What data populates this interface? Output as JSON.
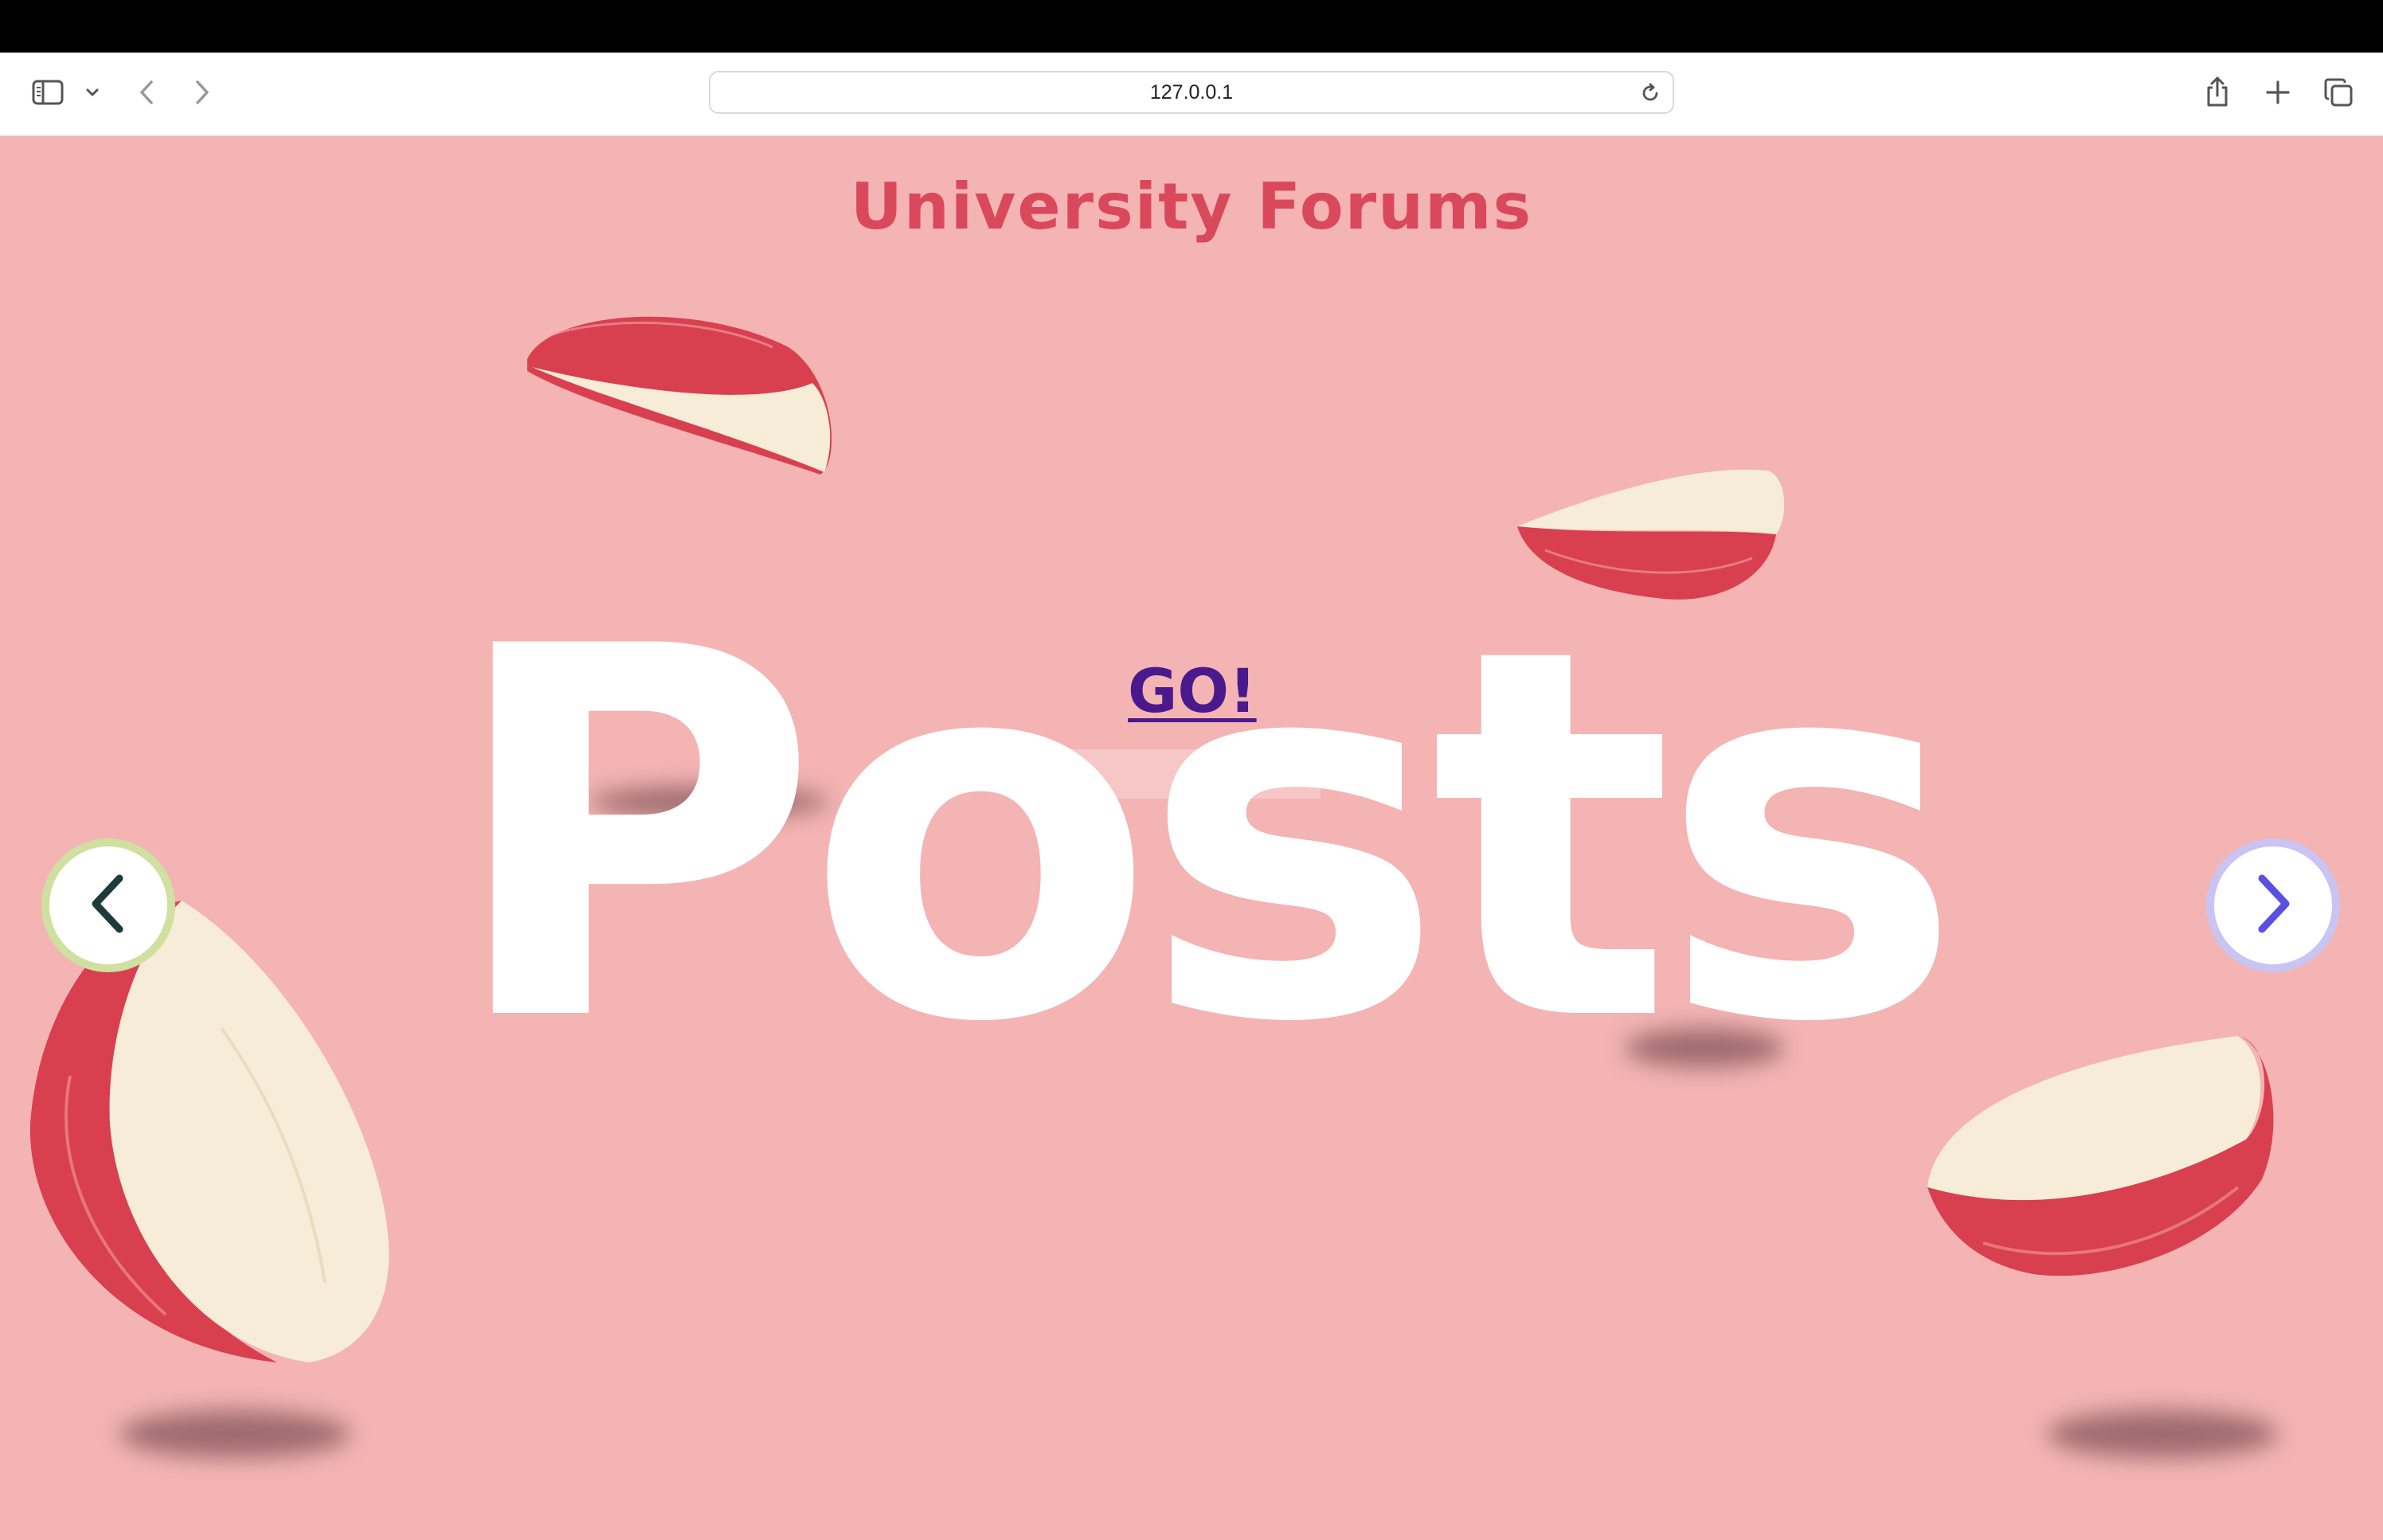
{
  "browser": {
    "url": "127.0.0.1",
    "icons": {
      "sidebar": "sidebar-icon",
      "dropdown": "chevron-down-icon",
      "back": "back-arrow-icon",
      "forward": "forward-arrow-icon",
      "reload": "reload-icon",
      "share": "share-icon",
      "new_tab": "plus-icon",
      "tabs": "tabs-overview-icon"
    }
  },
  "page": {
    "title": "University Forums",
    "hero_word": "Posts",
    "go_link": "GO!",
    "colors": {
      "background": "#f4b4b4",
      "title": "#d9495b",
      "go_link": "#4a1a8c",
      "prev_ring": "#cfe0a0",
      "next_ring": "#c9c4f2",
      "prev_arrow": "#1f3a3a",
      "next_arrow": "#5b4fe0"
    },
    "carousel": {
      "prev_icon": "chevron-left-icon",
      "next_icon": "chevron-right-icon"
    }
  }
}
